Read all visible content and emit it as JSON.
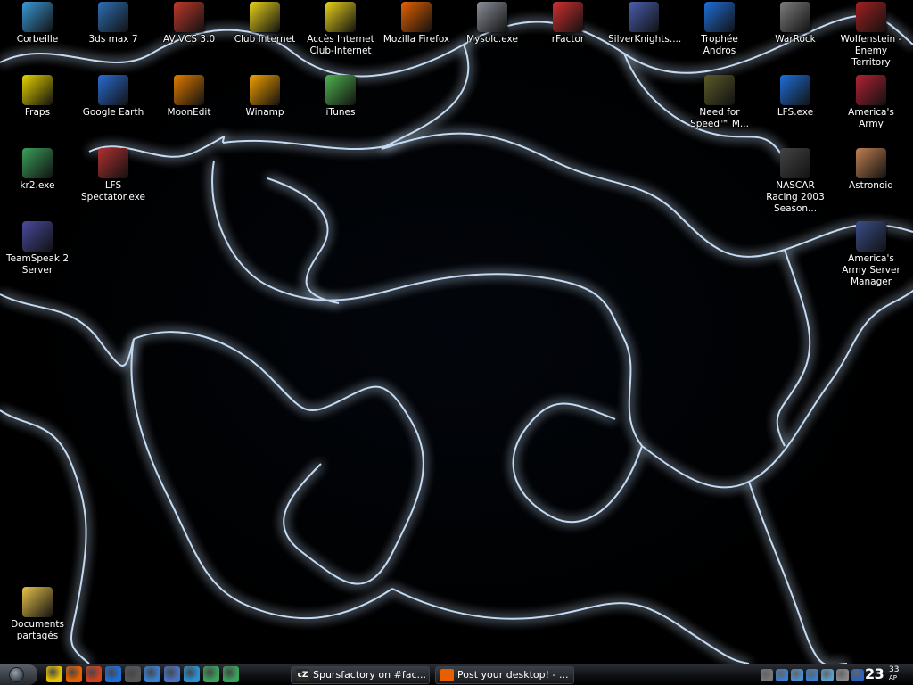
{
  "desktop": {
    "icons": [
      {
        "label": "Corbeille",
        "icon": "recycle-bin-icon",
        "color": "#3a9bd8"
      },
      {
        "label": "3ds max 7",
        "icon": "3dsmax-icon",
        "color": "#2d6fb5"
      },
      {
        "label": "AV VCS 3.0",
        "icon": "av-vcs-icon",
        "color": "#c0392b"
      },
      {
        "label": "Club Internet",
        "icon": "club-internet-icon",
        "color": "#e8d21a"
      },
      {
        "label": "Accès Internet Club-Internet",
        "icon": "club-internet-access-icon",
        "color": "#e8d21a"
      },
      {
        "label": "Mozilla Firefox",
        "icon": "firefox-icon",
        "color": "#e66000"
      },
      {
        "label": "Mysolc.exe",
        "icon": "car-icon",
        "color": "#8a8f99"
      },
      {
        "label": "rFactor",
        "icon": "rfactor-icon",
        "color": "#d32f2f"
      },
      {
        "label": "SilverKnights....",
        "icon": "silverknights-icon",
        "color": "#4a5fb0"
      },
      {
        "label": "Trophée Andros",
        "icon": "trophee-andros-icon",
        "color": "#1e6fd9"
      },
      {
        "label": "WarRock",
        "icon": "warrock-icon",
        "color": "#7d7d7d"
      },
      {
        "label": "Wolfenstein - Enemy Territory",
        "icon": "wolfenstein-icon",
        "color": "#a32020"
      },
      {
        "label": "Fraps",
        "icon": "fraps-icon",
        "color": "#e6d300"
      },
      {
        "label": "Google Earth",
        "icon": "google-earth-icon",
        "color": "#2a6bd1"
      },
      {
        "label": "MoonEdit",
        "icon": "moonedit-icon",
        "color": "#e07b00"
      },
      {
        "label": "Winamp",
        "icon": "winamp-icon",
        "color": "#f0a000"
      },
      {
        "label": "iTunes",
        "icon": "itunes-icon",
        "color": "#4fb34f"
      },
      {
        "label": "Need for Speed™ M...",
        "icon": "nfs-mw-icon",
        "color": "#5a5a2a"
      },
      {
        "label": "LFS.exe",
        "icon": "lfs-icon",
        "color": "#1e6fd9"
      },
      {
        "label": "America's Army",
        "icon": "americas-army-icon",
        "color": "#b22234"
      },
      {
        "label": "kr2.exe",
        "icon": "kr2-icon",
        "color": "#3aa05a"
      },
      {
        "label": "LFS Spectator.exe",
        "icon": "lfs-spectator-icon",
        "color": "#b03030"
      },
      {
        "label": "NASCAR Racing 2003 Season...",
        "icon": "tire-icon",
        "color": "#444444"
      },
      {
        "label": "Astronoid",
        "icon": "astronoid-icon",
        "color": "#c08050"
      },
      {
        "label": "TeamSpeak 2 Server",
        "icon": "teamspeak-icon",
        "color": "#4a4aa0"
      },
      {
        "label": "America's Army Server Manager",
        "icon": "americas-army-server-icon",
        "color": "#3a4f8a"
      },
      {
        "label": "Documents partagés",
        "icon": "folder-icon",
        "color": "#e8c34a"
      }
    ]
  },
  "taskbar": {
    "quicklaunch": [
      {
        "icon": "show-desktop-icon",
        "color": "#e6c200"
      },
      {
        "icon": "firefox-icon",
        "color": "#e66000"
      },
      {
        "icon": "moonedit-icon",
        "color": "#d04020"
      },
      {
        "icon": "trophee-andros-icon",
        "color": "#1e6fd9"
      },
      {
        "icon": "media-icon",
        "color": "#555555"
      },
      {
        "icon": "shield-icon",
        "color": "#3a7fd0"
      },
      {
        "icon": "headset-icon",
        "color": "#4a70c0"
      },
      {
        "icon": "search-icon",
        "color": "#2a90d0"
      },
      {
        "icon": "refresh-icon",
        "color": "#3aa05a"
      },
      {
        "icon": "globe-icon",
        "color": "#3aa05a"
      }
    ],
    "tasks": [
      {
        "label": "Spursfactory on #fac...",
        "icon": "chat-icon",
        "icon_text": "cZ",
        "color": "#2a2a2a"
      },
      {
        "label": "Post your desktop! - ...",
        "icon": "firefox-icon",
        "icon_text": "",
        "color": "#e66000"
      }
    ],
    "tray": [
      {
        "icon": "volume-icon",
        "color": "#777777"
      },
      {
        "icon": "network-icon",
        "color": "#3a7fd0"
      },
      {
        "icon": "monitor-icon",
        "color": "#4a90d0"
      },
      {
        "icon": "shield-icon",
        "color": "#3a7fd0"
      },
      {
        "icon": "wireless-icon",
        "color": "#5aa0d0"
      },
      {
        "icon": "speaker-icon",
        "color": "#888888"
      },
      {
        "icon": "antivirus-icon",
        "color": "#2a60c0"
      }
    ],
    "clock": {
      "hour_minute": "23",
      "minutes": "33",
      "ampm": "AP"
    }
  }
}
